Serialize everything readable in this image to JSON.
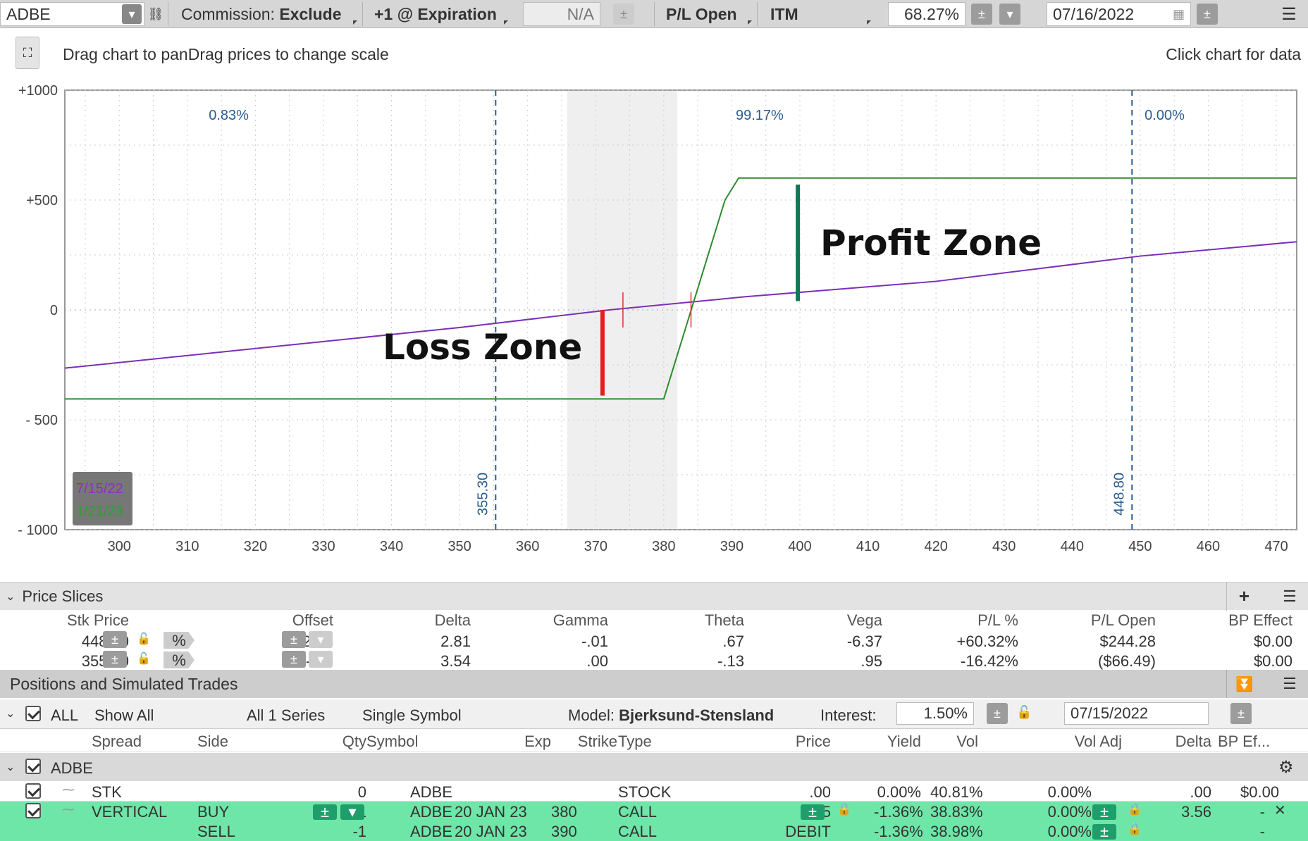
{
  "toolbar": {
    "symbol": "ADBE",
    "commission": "Commission: ",
    "commission_val": "Exclude",
    "expiration": "+1 @ Expiration",
    "na": "N/A",
    "pl_open": "P/L Open",
    "itm": "ITM",
    "prob": "68.27%",
    "date": "07/16/2022"
  },
  "chartbar": {
    "hint": "Drag chart to panDrag prices to change scale",
    "click": "Click chart for data"
  },
  "chart_data": {
    "type": "line",
    "x_ticks": [
      300,
      310,
      320,
      330,
      340,
      350,
      360,
      370,
      380,
      390,
      400,
      410,
      420,
      430,
      440,
      450,
      460,
      470
    ],
    "y_ticks": [
      "+1000",
      "+500",
      "0",
      "- 500",
      "- 1000"
    ],
    "xlim": [
      292,
      473
    ],
    "ylim": [
      -1000,
      1000
    ],
    "series": [
      {
        "name": "7/15/22",
        "color": "#7b2fb8",
        "points": [
          [
            292,
            -265
          ],
          [
            350,
            -80
          ],
          [
            372,
            0
          ],
          [
            392,
            60
          ],
          [
            420,
            130
          ],
          [
            450,
            245
          ],
          [
            473,
            310
          ]
        ]
      },
      {
        "name": "1/21/23",
        "color": "#2e8b2e",
        "points": [
          [
            292,
            -405
          ],
          [
            380,
            -405
          ],
          [
            389,
            500
          ],
          [
            391,
            600
          ],
          [
            473,
            600
          ]
        ]
      }
    ],
    "vlines": [
      {
        "x": 355.3,
        "label": "355.30"
      },
      {
        "x": 448.8,
        "label": "448.80"
      }
    ],
    "pcts": [
      "0.83%",
      "99.17%",
      "0.00%"
    ],
    "annotations": {
      "loss": "Loss Zone",
      "profit": "Profit Zone"
    },
    "legend": [
      "7/15/22",
      "1/21/23"
    ],
    "grid": true
  },
  "price_slices": {
    "title": "Price Slices",
    "headers": [
      "Stk Price",
      "Offset",
      "Delta",
      "Gamma",
      "Theta",
      "Vega",
      "P/L %",
      "P/L Open",
      "BP Effect"
    ],
    "rows": [
      [
        "448.80",
        "%",
        "+20%",
        "2.81",
        "-.01",
        ".67",
        "-6.37",
        "+60.32%",
        "$244.28",
        "$0.00"
      ],
      [
        "355.30",
        "%",
        "-5%",
        "3.54",
        ".00",
        "-.13",
        ".95",
        "-16.42%",
        "($66.49)",
        "$0.00"
      ]
    ]
  },
  "positions": {
    "title": "Positions and Simulated Trades",
    "all": "ALL",
    "show_all": "Show All",
    "series": "All 1 Series",
    "single": "Single Symbol",
    "model_lbl": "Model: ",
    "model": "Bjerksund-Stensland",
    "interest_lbl": "Interest:",
    "interest": "1.50%",
    "date": "07/15/2022",
    "headers": [
      "Spread",
      "Side",
      "Qty",
      "Symbol",
      "Exp",
      "Strike",
      "Type",
      "Price",
      "Yield",
      "Vol",
      "Vol Adj",
      "Delta",
      "BP Ef..."
    ],
    "group": "ADBE",
    "rows": [
      {
        "spread": "STK",
        "side": "",
        "qty": "0",
        "symbol": "ADBE",
        "exp": "",
        "strike": "",
        "type": "STOCK",
        "price": ".00",
        "yield": "0.00%",
        "vol": "40.81%",
        "voladj": "0.00%",
        "delta": ".00",
        "bp": "$0.00"
      },
      {
        "spread": "VERTICAL",
        "side": "BUY",
        "qty": "+1",
        "symbol": "ADBE",
        "exp": "20 JAN 23",
        "strike": "380",
        "type": "CALL",
        "price": "4.05",
        "yield": "-1.36%",
        "vol": "38.83%",
        "voladj": "0.00%",
        "delta": "3.56",
        "bp": "-"
      },
      {
        "spread": "",
        "side": "SELL",
        "qty": "-1",
        "symbol": "ADBE",
        "exp": "20 JAN 23",
        "strike": "390",
        "type": "CALL",
        "price": "DEBIT",
        "yield": "-1.36%",
        "vol": "38.98%",
        "voladj": "0.00%",
        "delta": "",
        "bp": "-"
      }
    ]
  }
}
